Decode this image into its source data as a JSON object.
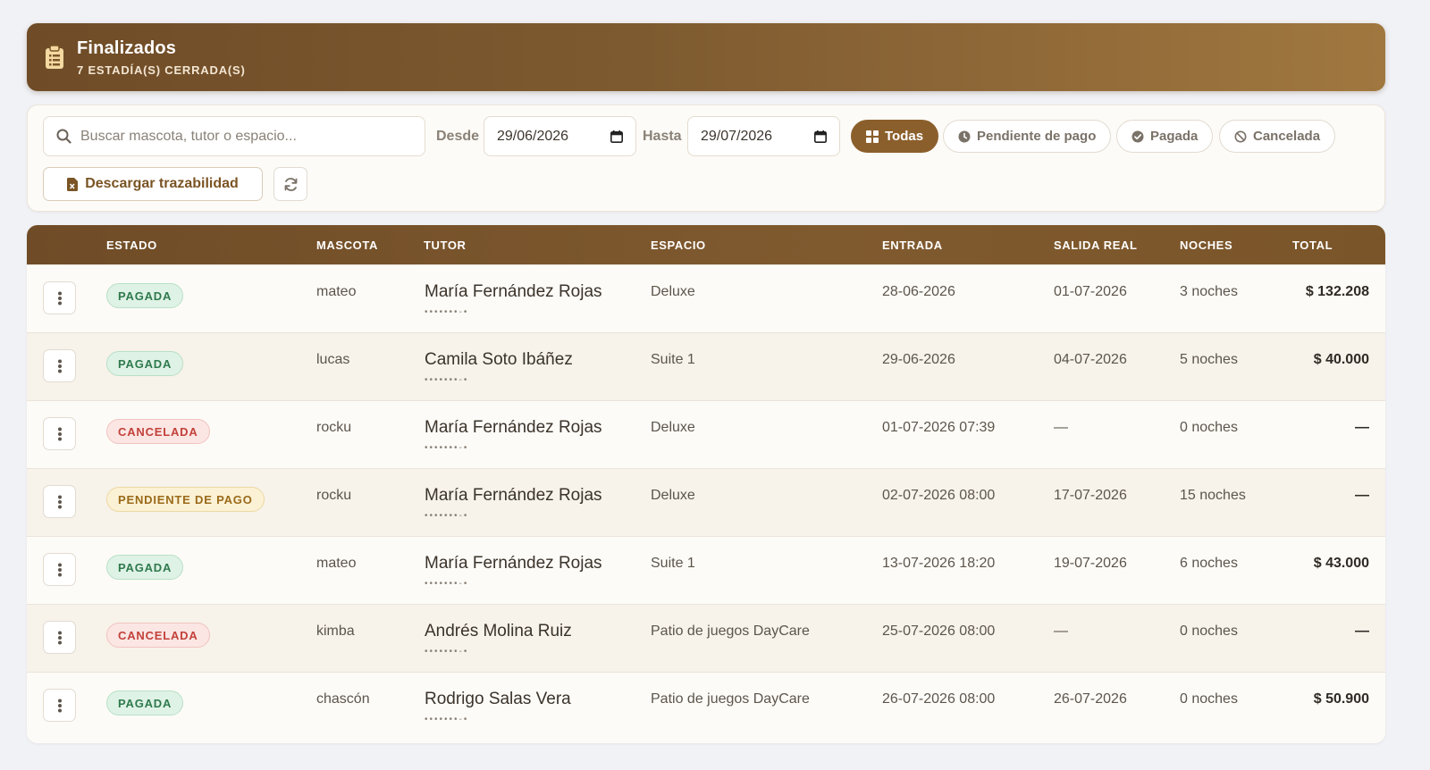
{
  "header": {
    "title": "Finalizados",
    "subtitle": "7 ESTADÍA(S) CERRADA(S)",
    "icon": "clipboard-icon",
    "gradient": [
      "#6f4c27",
      "#a0773f"
    ]
  },
  "filters": {
    "search_placeholder": "Buscar mascota, tutor o espacio...",
    "desde_label": "Desde",
    "desde_value": "29/06/2026",
    "hasta_label": "Hasta",
    "hasta_value": "29/07/2026",
    "status_pills": [
      {
        "label": "Todas",
        "icon": "grid-icon",
        "active": true
      },
      {
        "label": "Pendiente de pago",
        "icon": "clock-icon",
        "active": false
      },
      {
        "label": "Pagada",
        "icon": "check-circle-icon",
        "active": false
      },
      {
        "label": "Cancelada",
        "icon": "ban-icon",
        "active": false
      }
    ],
    "download_label": "Descargar trazabilidad",
    "accent": "#8b5f2c"
  },
  "table": {
    "columns": [
      "ESTADO",
      "MASCOTA",
      "TUTOR",
      "ESPACIO",
      "ENTRADA",
      "SALIDA REAL",
      "NOCHES",
      "TOTAL"
    ],
    "rows": [
      {
        "estado": "PAGADA",
        "status": "pagada",
        "mascota": "mateo",
        "tutor": "María Fernández Rojas",
        "phone": "•••••••-•",
        "espacio": "Deluxe",
        "entrada": "28-06-2026",
        "salida": "01-07-2026",
        "noches": "3 noches",
        "total": "$ 132.208"
      },
      {
        "estado": "PAGADA",
        "status": "pagada",
        "mascota": "lucas",
        "tutor": "Camila Soto Ibáñez",
        "phone": "•••••••-•",
        "espacio": "Suite 1",
        "entrada": "29-06-2026",
        "salida": "04-07-2026",
        "noches": "5 noches",
        "total": "$ 40.000"
      },
      {
        "estado": "CANCELADA",
        "status": "cancelada",
        "mascota": "rocku",
        "tutor": "María Fernández Rojas",
        "phone": "•••••••-•",
        "espacio": "Deluxe",
        "entrada": "01-07-2026 07:39",
        "salida": "—",
        "noches": "0 noches",
        "total": "—"
      },
      {
        "estado": "PENDIENTE DE PAGO",
        "status": "pendiente",
        "mascota": "rocku",
        "tutor": "María Fernández Rojas",
        "phone": "•••••••-•",
        "espacio": "Deluxe",
        "entrada": "02-07-2026 08:00",
        "salida": "17-07-2026",
        "noches": "15 noches",
        "total": "—"
      },
      {
        "estado": "PAGADA",
        "status": "pagada",
        "mascota": "mateo",
        "tutor": "María Fernández Rojas",
        "phone": "•••••••-•",
        "espacio": "Suite 1",
        "entrada": "13-07-2026 18:20",
        "salida": "19-07-2026",
        "noches": "6 noches",
        "total": "$ 43.000"
      },
      {
        "estado": "CANCELADA",
        "status": "cancelada",
        "mascota": "kimba",
        "tutor": "Andrés Molina Ruiz",
        "phone": "•••••••-•",
        "espacio": "Patio de juegos DayCare",
        "entrada": "25-07-2026 08:00",
        "salida": "—",
        "noches": "0 noches",
        "total": "—"
      },
      {
        "estado": "PAGADA",
        "status": "pagada",
        "mascota": "chascón",
        "tutor": "Rodrigo Salas Vera",
        "phone": "•••••••-•",
        "espacio": "Patio de juegos DayCare",
        "entrada": "26-07-2026 08:00",
        "salida": "26-07-2026",
        "noches": "0 noches",
        "total": "$ 50.900"
      }
    ],
    "status_colors": {
      "pagada": "#2f7a4d",
      "cancelada": "#c2413a",
      "pendiente": "#9a6a1a"
    }
  }
}
